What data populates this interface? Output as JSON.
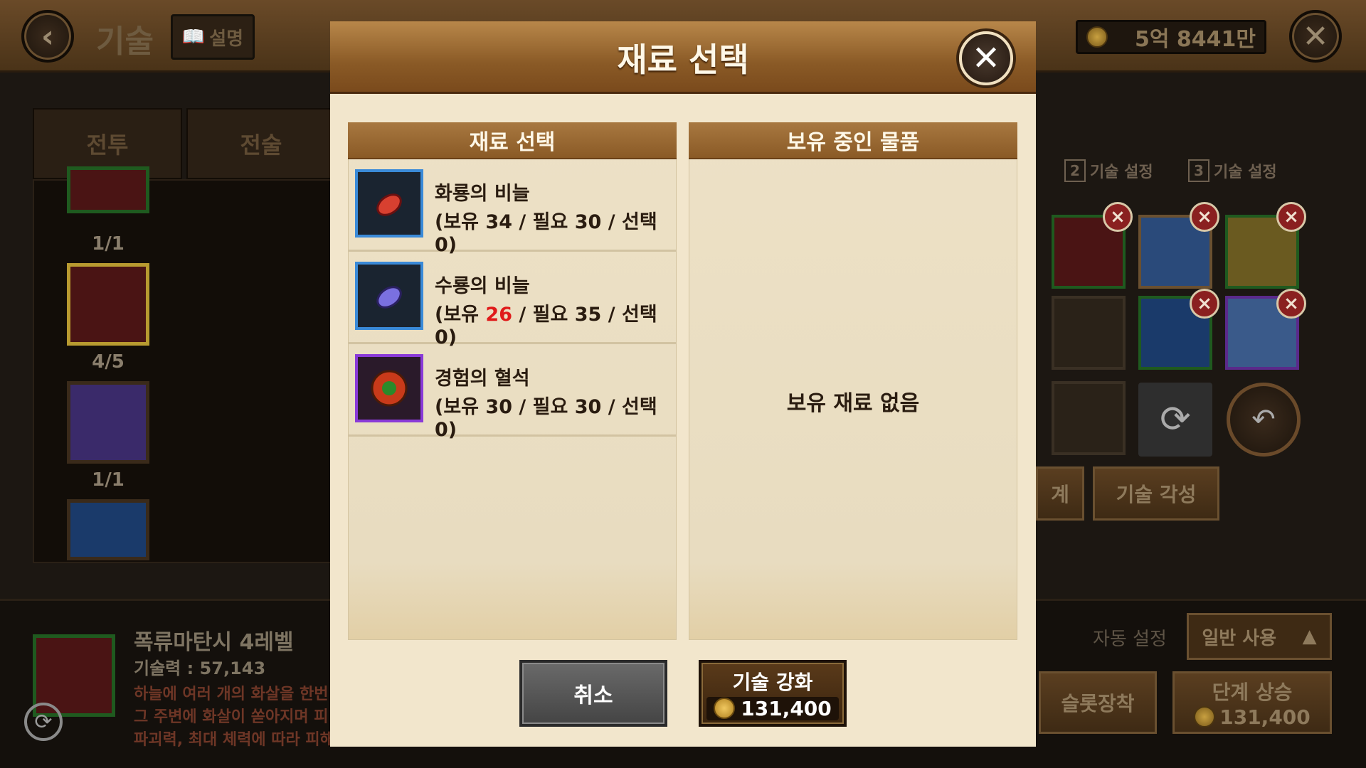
{
  "header": {
    "back_icon": "back-arrow-icon",
    "title": "기술",
    "help_label": "설명",
    "gold": "5억 8441만",
    "close_icon": "close-icon"
  },
  "left_tabs": [
    "전투",
    "전술"
  ],
  "skill_list": [
    {
      "label": "1/1"
    },
    {
      "label": "4/5"
    },
    {
      "label": "1/1"
    }
  ],
  "slot_tabs": [
    {
      "num": "2",
      "label": "기술 설정"
    },
    {
      "num": "3",
      "label": "기술 설정"
    }
  ],
  "right_buttons": {
    "stage_partial": "계",
    "awaken": "기술 각성"
  },
  "bottom": {
    "skill_name": "폭류마탄시 4레벨",
    "skill_power": "기술력 : 57,143",
    "desc_line1": "하늘에 여러 개의 화살을 한번",
    "desc_line2": "그 주변에 화살이 쏟아지며 피",
    "desc_line3": "파괴력, 최대 체력에 따라 피해",
    "auto_label": "자동 설정",
    "auto_value": "일반 사용",
    "slot_equip": "슬롯장착",
    "level_up": "단계 상승",
    "level_up_cost": "131,400"
  },
  "dialog": {
    "title": "재료 선택",
    "left_header": "재료 선택",
    "right_header": "보유 중인 물품",
    "empty_text": "보유 재료 없음",
    "items": [
      {
        "name": "화룡의 비늘",
        "qty_prefix": "(보유 ",
        "owned": "34",
        "qty_suffix": " / 필요 30 / 선택 0)",
        "owned_color": "#2a1c10"
      },
      {
        "name": "수룡의 비늘",
        "qty_prefix": "(보유 ",
        "owned": "26",
        "qty_suffix": " / 필요 35 / 선택 0)",
        "owned_color": "#e01a1a"
      },
      {
        "name": "경험의 혈석",
        "qty_prefix": "(보유 ",
        "owned": "30",
        "qty_suffix": " / 필요 30 / 선택 0)",
        "owned_color": "#2a1c10"
      }
    ],
    "cancel_label": "취소",
    "enhance_label": "기술 강화",
    "enhance_cost": "131,400"
  }
}
